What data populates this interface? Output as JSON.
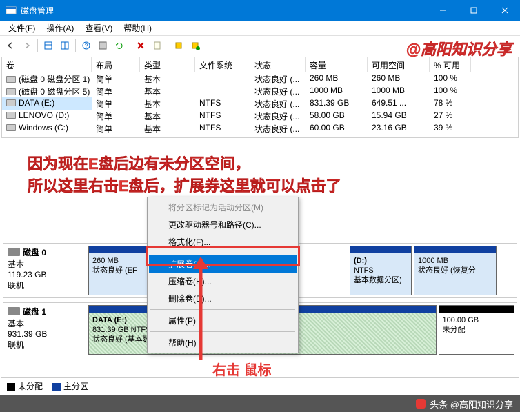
{
  "window": {
    "title": "磁盘管理"
  },
  "menu": {
    "file": "文件(F)",
    "action": "操作(A)",
    "view": "查看(V)",
    "help": "帮助(H)"
  },
  "watermark": "@高阳知识分享",
  "columns": [
    "卷",
    "布局",
    "类型",
    "文件系统",
    "状态",
    "容量",
    "可用空间",
    "% 可用"
  ],
  "rows": [
    {
      "v": "(磁盘 0 磁盘分区 1)",
      "l": "简单",
      "t": "基本",
      "fs": "",
      "st": "状态良好 (...",
      "cap": "260 MB",
      "free": "260 MB",
      "pct": "100 %",
      "sel": false
    },
    {
      "v": "(磁盘 0 磁盘分区 5)",
      "l": "简单",
      "t": "基本",
      "fs": "",
      "st": "状态良好 (...",
      "cap": "1000 MB",
      "free": "1000 MB",
      "pct": "100 %",
      "sel": false
    },
    {
      "v": "DATA (E:)",
      "l": "简单",
      "t": "基本",
      "fs": "NTFS",
      "st": "状态良好 (...",
      "cap": "831.39 GB",
      "free": "649.51 ...",
      "pct": "78 %",
      "sel": true
    },
    {
      "v": "LENOVO (D:)",
      "l": "简单",
      "t": "基本",
      "fs": "NTFS",
      "st": "状态良好 (...",
      "cap": "58.00 GB",
      "free": "15.94 GB",
      "pct": "27 %",
      "sel": false
    },
    {
      "v": "Windows (C:)",
      "l": "简单",
      "t": "基本",
      "fs": "NTFS",
      "st": "状态良好 (...",
      "cap": "60.00 GB",
      "free": "23.16 GB",
      "pct": "39 %",
      "sel": false
    }
  ],
  "annotation": {
    "l1": "因为现在E盘后边有未分区空间，",
    "l2": "所以这里右击E盘后，扩展券这里就可以点击了",
    "mouse": "右击 鼠标"
  },
  "context": {
    "mark": "将分区标记为活动分区(M)",
    "drive": "更改驱动器号和路径(C)...",
    "format": "格式化(F)...",
    "extend": "扩展卷(X)...",
    "shrink": "压缩卷(H)...",
    "delete": "删除卷(D)...",
    "prop": "属性(P)",
    "help": "帮助(H)"
  },
  "disk0": {
    "name": "磁盘 0",
    "type": "基本",
    "size": "119.23 GB",
    "status": "联机",
    "p1": {
      "size": "260 MB",
      "st": "状态良好 (EF"
    },
    "p4": {
      "name": "(D:)",
      "fs": "NTFS",
      "st": "基本数据分区)"
    },
    "p5": {
      "size": "1000 MB",
      "st": "状态良好 (恢复分"
    }
  },
  "disk1": {
    "name": "磁盘 1",
    "type": "基本",
    "size": "931.39 GB",
    "status": "联机",
    "p1": {
      "name": "DATA  (E:)",
      "sub": "831.39 GB NTFS",
      "st": "状态良好 (基本数据分区)"
    },
    "p2": {
      "size": "100.00 GB",
      "st": "未分配"
    }
  },
  "legend": {
    "unalloc": "未分配",
    "primary": "主分区"
  },
  "footer": "头条 @高阳知识分享"
}
